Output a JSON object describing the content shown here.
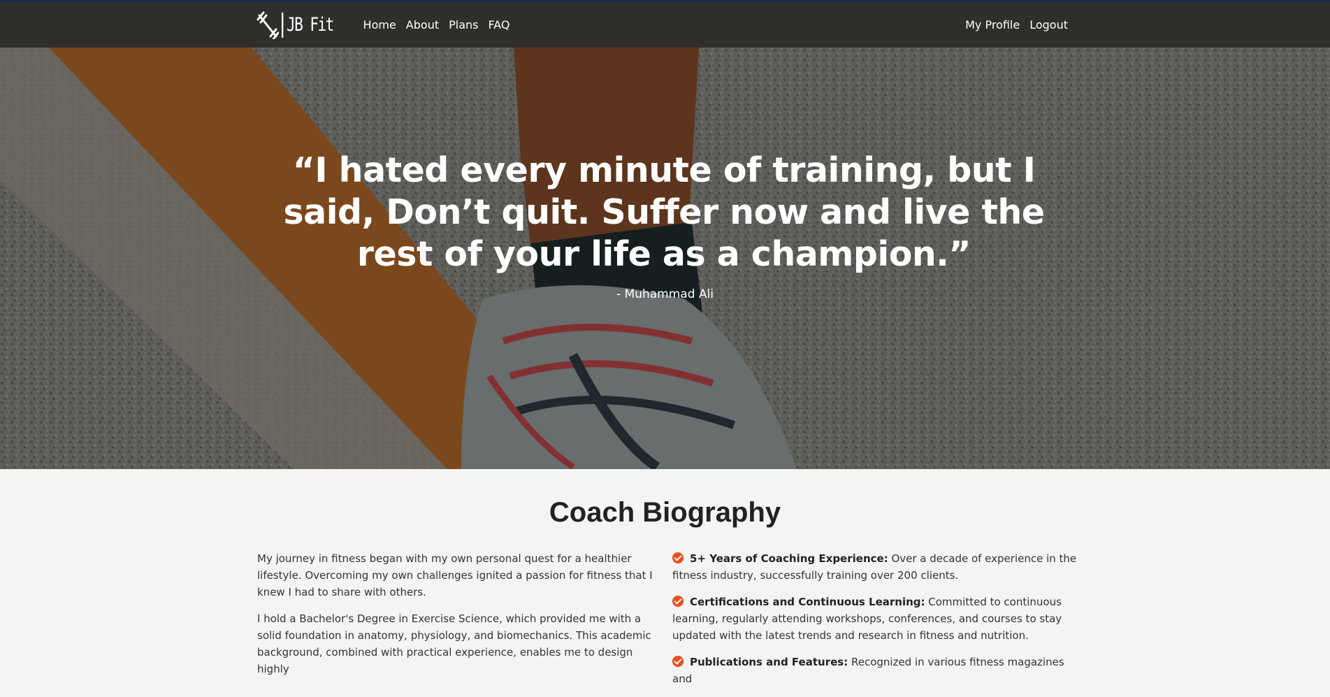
{
  "nav": {
    "brand": "JB Fit",
    "links": [
      {
        "label": "Home"
      },
      {
        "label": "About"
      },
      {
        "label": "Plans"
      },
      {
        "label": "FAQ"
      }
    ],
    "right_links": [
      {
        "label": "My Profile"
      },
      {
        "label": "Logout"
      }
    ]
  },
  "hero": {
    "quote": "“I hated every minute of training, but I said, Don’t quit. Suffer now and live the rest of your life as a champion.”",
    "author": "- Muhammad Ali"
  },
  "bio": {
    "title": "Coach Biography",
    "paragraphs": [
      "My journey in fitness began with my own personal quest for a healthier lifestyle. Overcoming my own challenges ignited a passion for fitness that I knew I had to share with others.",
      "I hold a Bachelor's Degree in Exercise Science, which provided me with a solid foundation in anatomy, physiology, and biomechanics. This academic background, combined with practical experience, enables me to design highly"
    ],
    "highlights": [
      {
        "title": "5+ Years of Coaching Experience:",
        "text": " Over a decade of experience in the fitness industry, successfully training over 200 clients."
      },
      {
        "title": "Certifications and Continuous Learning:",
        "text": " Committed to continuous learning, regularly attending workshops, conferences, and courses to stay updated with the latest trends and research in fitness and nutrition."
      },
      {
        "title": "Publications and Features:",
        "text": " Recognized in various fitness magazines and"
      }
    ],
    "accent_color": "#ee4d1a"
  }
}
